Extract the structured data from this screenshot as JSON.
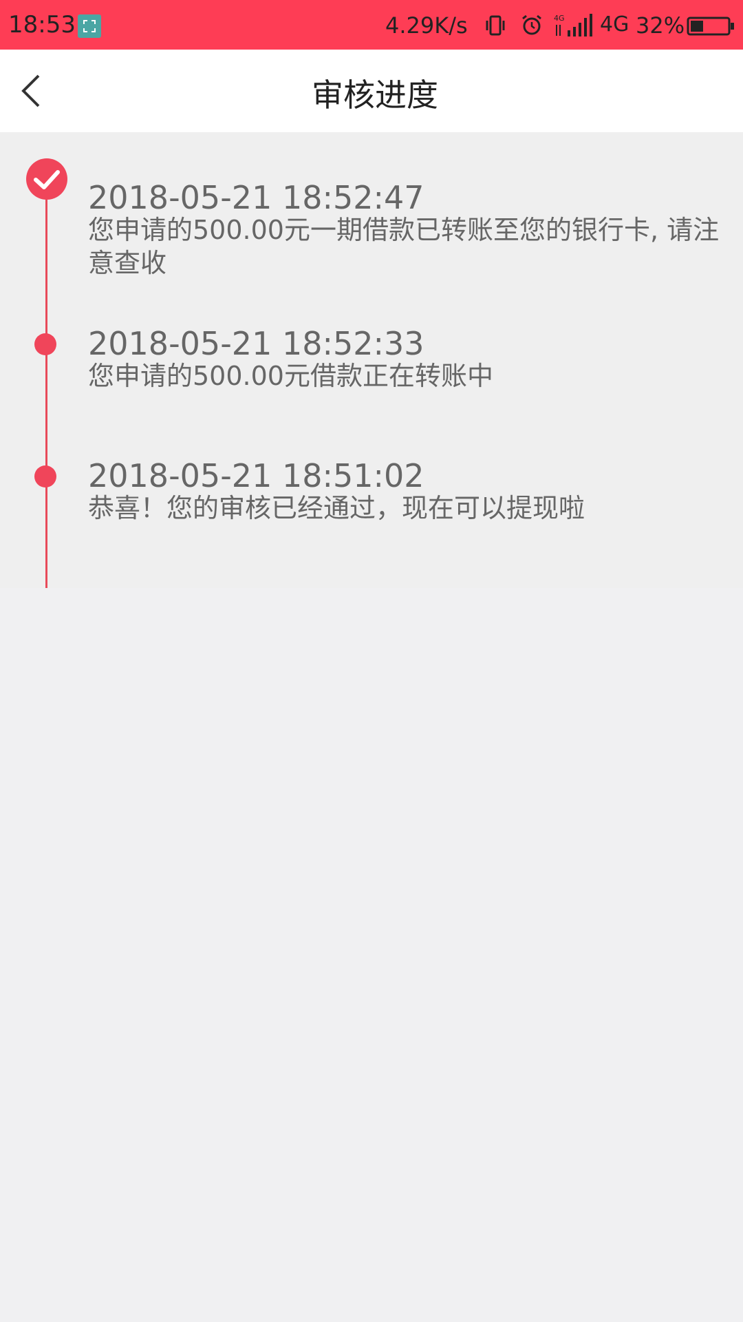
{
  "status_bar": {
    "time": "18:53",
    "network_speed": "4.29K/s",
    "network_type": "4G",
    "battery_percent": "32%",
    "background_color": "#fe3d55",
    "icons": [
      "screenshot-app-icon",
      "vibrate-icon",
      "alarm-icon",
      "signal-icon",
      "battery-icon"
    ]
  },
  "header": {
    "title": "审核进度",
    "back_icon": "back-chevron-icon"
  },
  "timeline": {
    "accent_color": "#f0455a",
    "entries": [
      {
        "time": "2018-05-21 18:52:47",
        "text": "您申请的500.00元一期借款已转账至您的银行卡, 请注意查收",
        "marker": "check-icon"
      },
      {
        "time": "2018-05-21 18:52:33",
        "text": "您申请的500.00元借款正在转账中",
        "marker": "dot"
      },
      {
        "time": "2018-05-21 18:51:02",
        "text": "恭喜！您的审核已经通过，现在可以提现啦",
        "marker": "dot"
      }
    ]
  }
}
